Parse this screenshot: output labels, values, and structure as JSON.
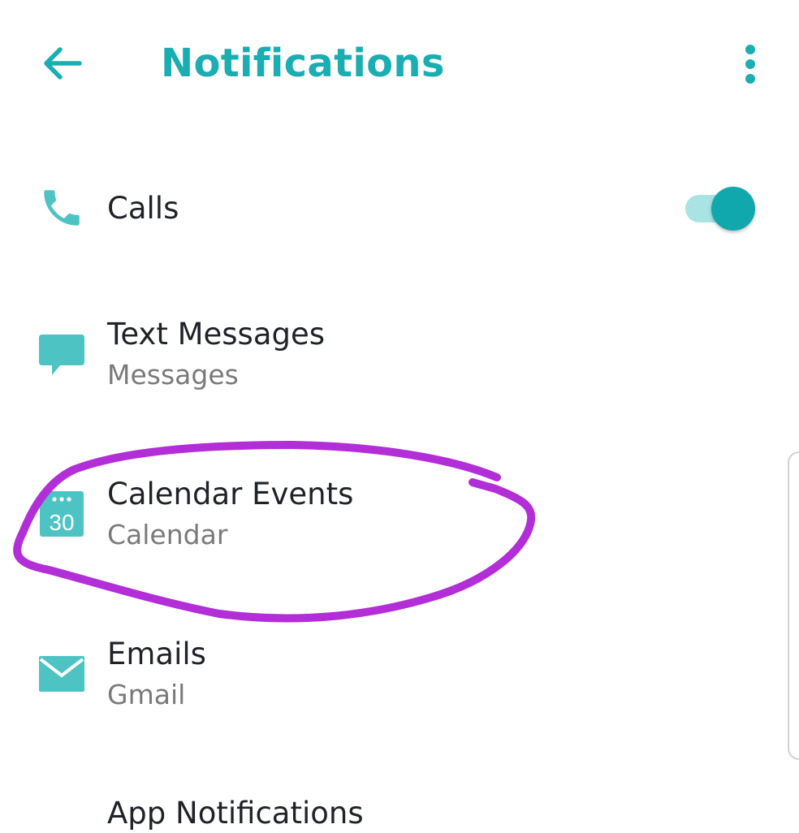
{
  "header": {
    "title": "Notifications",
    "back_icon": "arrow-left-icon",
    "menu_icon": "more-vert-icon"
  },
  "items": [
    {
      "label": "Calls",
      "sublabel": "",
      "icon": "phone-icon",
      "toggle_on": true
    },
    {
      "label": "Text Messages",
      "sublabel": "Messages",
      "icon": "message-icon"
    },
    {
      "label": "Calendar Events",
      "sublabel": "Calendar",
      "icon": "calendar-icon",
      "icon_text": "30"
    },
    {
      "label": "Emails",
      "sublabel": "Gmail",
      "icon": "mail-icon"
    },
    {
      "label": "App Notifications",
      "sublabel": ""
    }
  ],
  "colors": {
    "accent": "#1aaeb2",
    "icon": "#4ec3c3",
    "toggle_track": "#a9e3e3",
    "toggle_thumb": "#10a7ad",
    "annotation": "#b22ed6",
    "secondary_text": "#7a7a7a"
  }
}
